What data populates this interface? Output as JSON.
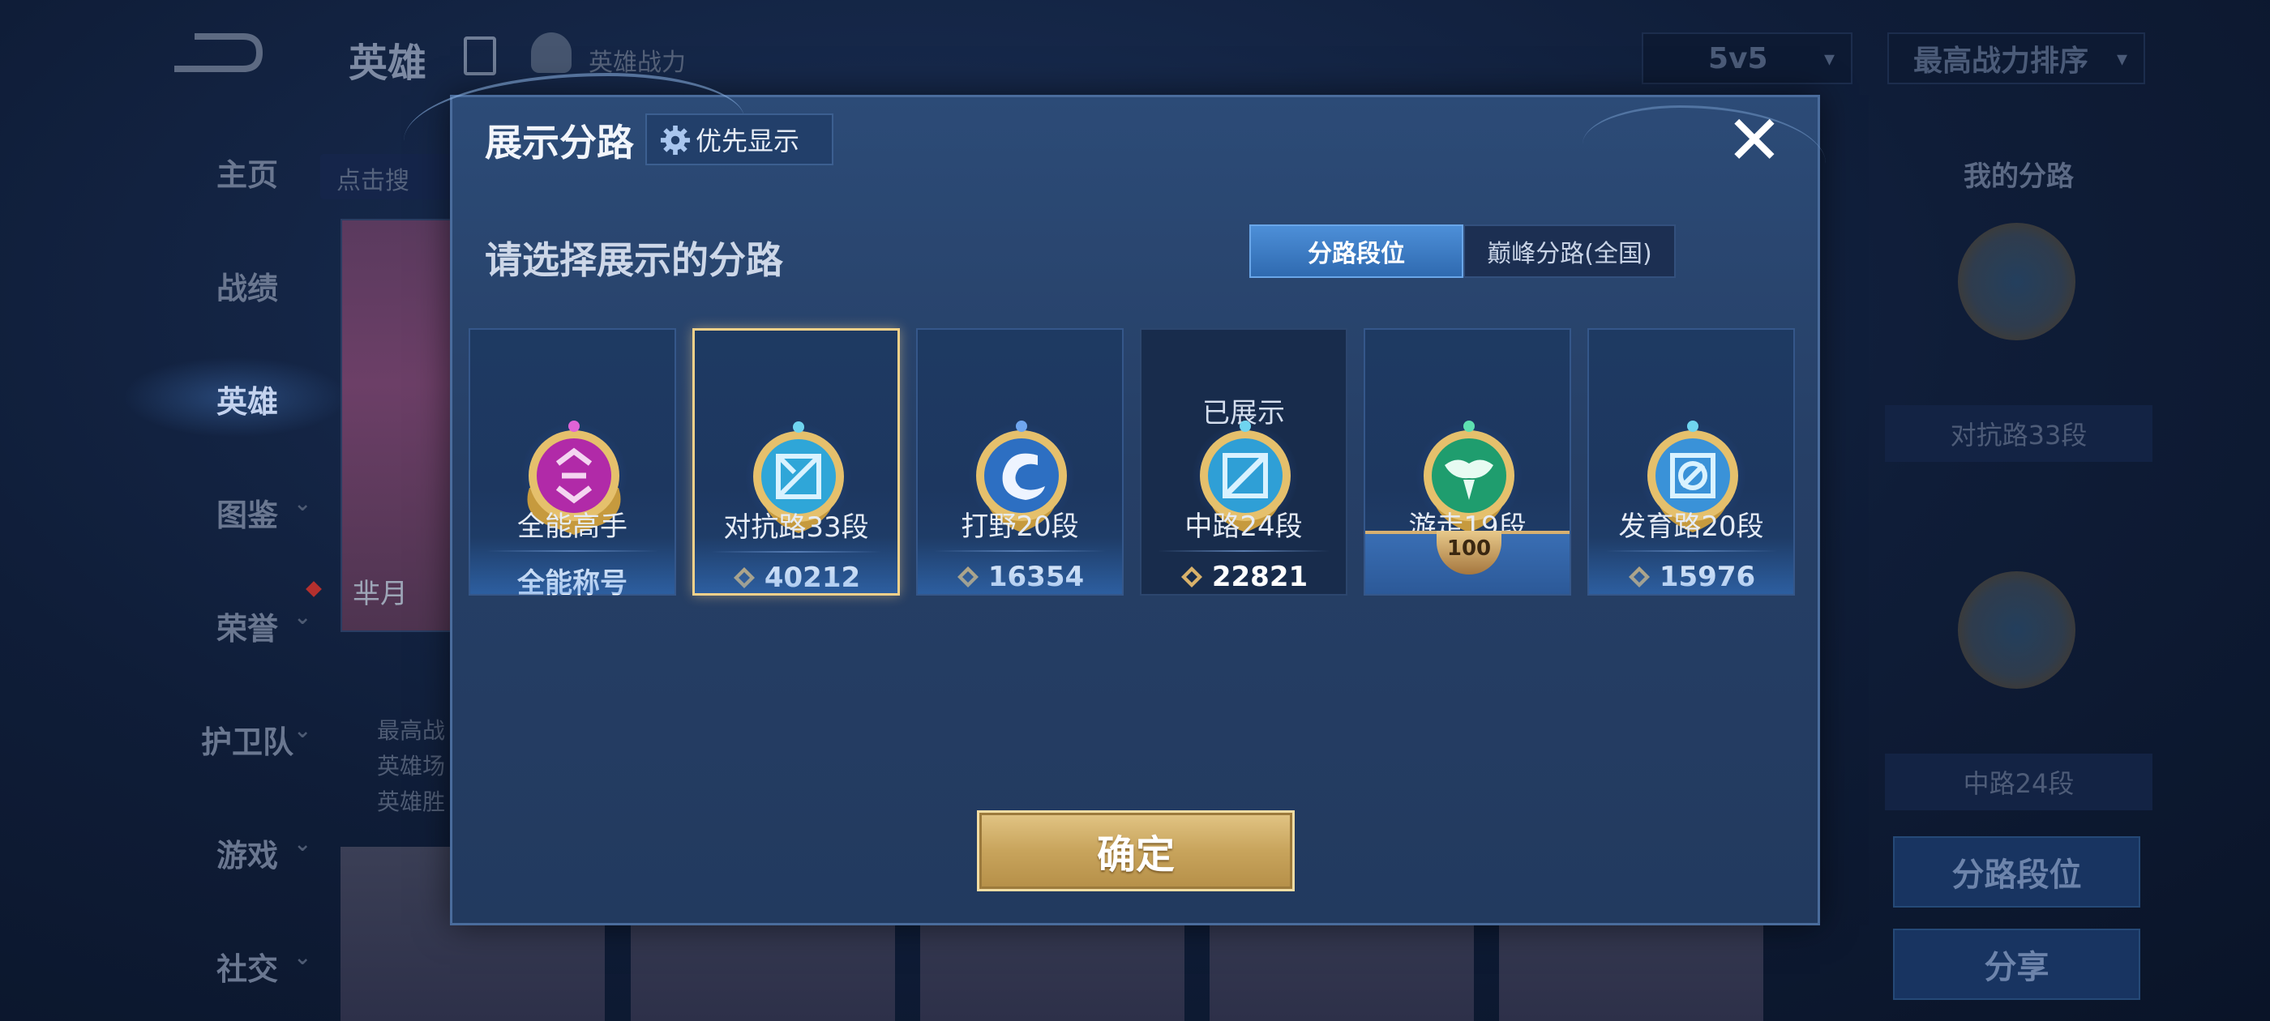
{
  "background": {
    "title": "英雄",
    "power_label": "英雄战力",
    "mode_select": "5v5",
    "sort_select": "最高战力排序",
    "nav": [
      {
        "label": "主页"
      },
      {
        "label": "战绩"
      },
      {
        "label": "英雄"
      },
      {
        "label": "图鉴"
      },
      {
        "label": "荣誉"
      },
      {
        "label": "护卫队"
      },
      {
        "label": "游戏"
      },
      {
        "label": "社交"
      }
    ],
    "search_hint": "点击搜",
    "hero_name": "芈月",
    "hero_stats": [
      "最高战",
      "英雄场",
      "英雄胜"
    ],
    "right_panel": {
      "title": "我的分路",
      "lane_1": "对抗路33段",
      "lane_2": "中路24段",
      "lane_button": "分路段位",
      "share_button": "分享"
    }
  },
  "modal": {
    "title": "展示分路",
    "priority_button": "优先显示",
    "subtitle": "请选择展示的分路",
    "tabs": [
      {
        "label": "分路段位",
        "active": true
      },
      {
        "label": "巅峰分路(全国)",
        "active": false
      }
    ],
    "cards": [
      {
        "lane": "全能高手",
        "value": "全能称号",
        "has_icon": false,
        "shown": "",
        "emblem_color": "#b12aa8"
      },
      {
        "lane": "对抗路33段",
        "value": "40212",
        "has_icon": true,
        "shown": "",
        "emblem_color": "#2fa6d8"
      },
      {
        "lane": "打野20段",
        "value": "16354",
        "has_icon": true,
        "shown": "",
        "emblem_color": "#2d6fc2"
      },
      {
        "lane": "中路24段",
        "value": "22821",
        "has_icon": true,
        "shown": "已展示",
        "emblem_color": "#2f9fd6"
      },
      {
        "lane": "游走19段",
        "value": "100",
        "has_icon": false,
        "shown": "",
        "emblem_color": "#1f9d6e"
      },
      {
        "lane": "发育路20段",
        "value": "15976",
        "has_icon": true,
        "shown": "",
        "emblem_color": "#3a92d8"
      }
    ],
    "confirm": "确定"
  }
}
